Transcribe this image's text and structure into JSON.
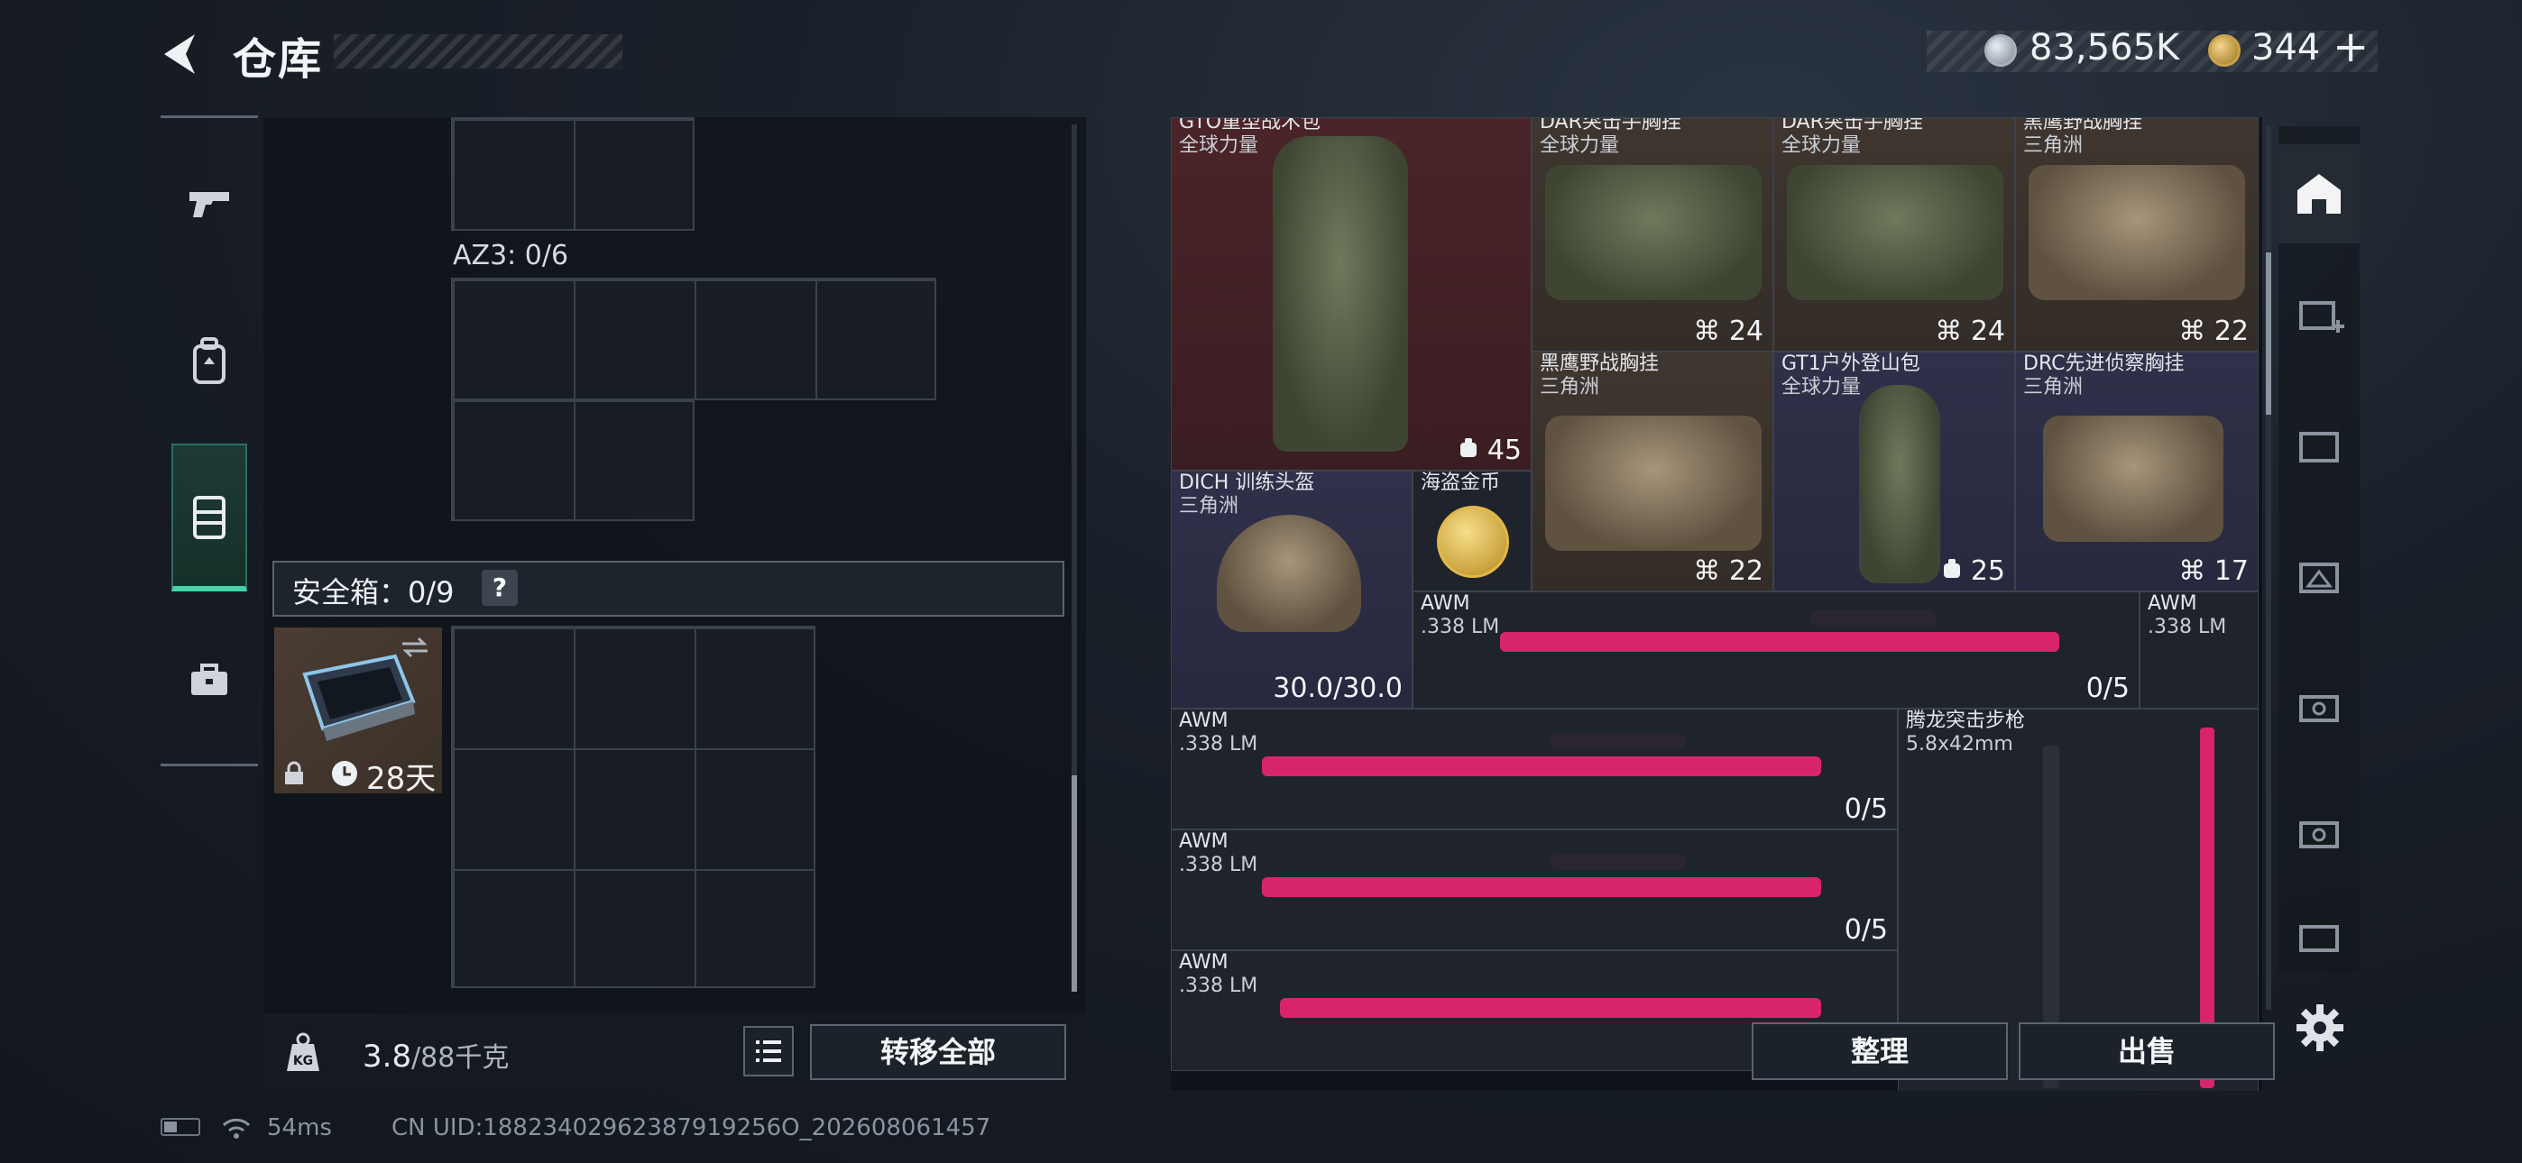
{
  "header": {
    "title": "仓库",
    "silver_value": "83,565K",
    "gold_value": "344",
    "plus": "+"
  },
  "left_nav": {
    "items": [
      {
        "icon": "pistol-icon",
        "active": false
      },
      {
        "icon": "backpack-icon",
        "active": false
      },
      {
        "icon": "vest-icon",
        "active": true
      },
      {
        "icon": "toolbox-icon",
        "active": false
      }
    ]
  },
  "storage": {
    "az3_label": "AZ3: 0/6",
    "safe_label": "安全箱：0/9",
    "safe_help": "?",
    "safebox_days": "28天",
    "weight_value": "3.8",
    "weight_cap": "/88千克",
    "transfer_all": "转移全部"
  },
  "inventory": {
    "items": [
      {
        "name": "GTO重型战术包",
        "sub": "全球力量",
        "count": "45",
        "count_icon": "backpack-icon"
      },
      {
        "name": "DAR突击手胸挂",
        "sub": "全球力量",
        "count": "24",
        "count_icon": "vest-icon"
      },
      {
        "name": "DAR突击手胸挂",
        "sub": "全球力量",
        "count": "24",
        "count_icon": "vest-icon"
      },
      {
        "name": "黑鹰野战胸挂",
        "sub": "三角洲",
        "count": "22",
        "count_icon": "vest-icon"
      },
      {
        "name": "黑鹰野战胸挂",
        "sub": "三角洲",
        "count": "22",
        "count_icon": "vest-icon"
      },
      {
        "name": "GT1户外登山包",
        "sub": "全球力量",
        "count": "25",
        "count_icon": "backpack-icon"
      },
      {
        "name": "DRC先进侦察胸挂",
        "sub": "三角洲",
        "count": "17",
        "count_icon": "vest-icon"
      },
      {
        "name": "DICH 训练头盔",
        "sub": "三角洲",
        "count": "30.0/30.0"
      },
      {
        "name": "海盗金币",
        "sub": ""
      },
      {
        "name": "AWM",
        "sub": ".338 LM",
        "count": "0/5"
      },
      {
        "name": "AWM",
        "sub": ".338 LM"
      },
      {
        "name": "AWM",
        "sub": ".338 LM",
        "count": "0/5"
      },
      {
        "name": "腾龙突击步枪",
        "sub": "5.8x42mm"
      },
      {
        "name": "AWM",
        "sub": ".338 LM",
        "count": "0/5"
      },
      {
        "name": "AWM",
        "sub": ".338 LM"
      }
    ],
    "tidy_button": "整理",
    "sell_button": "出售"
  },
  "status_bar": {
    "ping": "54ms",
    "uid": "CN UID:18823402962387919256O_202608061457"
  },
  "colors": {
    "accent_green": "#45d3a9",
    "rarity_red": "#4a2428",
    "rarity_purple": "#30304a",
    "rarity_brown": "#3f3630",
    "skin_pink": "#d8246a"
  }
}
